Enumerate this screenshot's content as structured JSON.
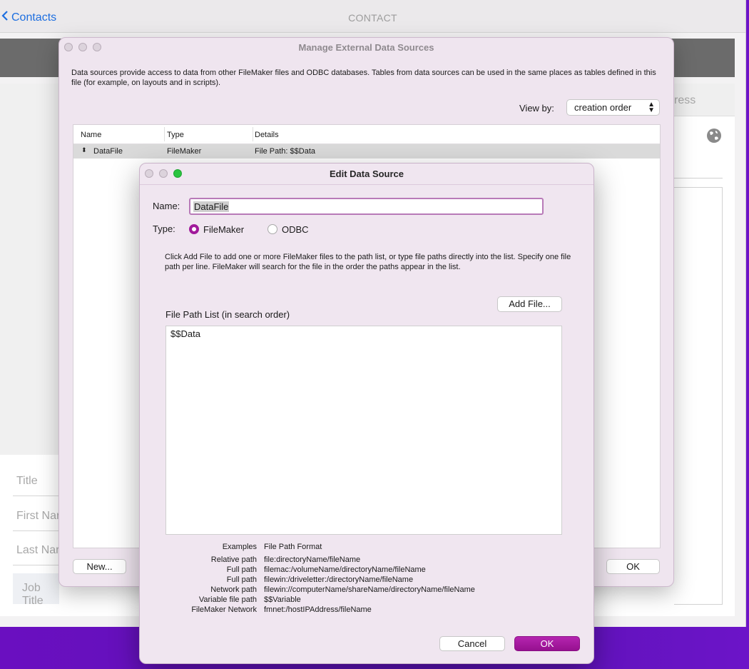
{
  "app": {
    "back_label": "Contacts",
    "title": "CONTACT",
    "tab_partial": "ress",
    "fields": [
      "Title",
      "First Nar",
      "Last Nar",
      "Job Title"
    ]
  },
  "manage": {
    "title": "Manage External Data Sources",
    "description": "Data sources provide access to data from other FileMaker files and ODBC databases. Tables from data sources can be used in the same places as tables defined in this file (for example, on layouts and in scripts).",
    "view_by_label": "View by:",
    "view_by_value": "creation order",
    "columns": [
      "Name",
      "Type",
      "Details"
    ],
    "rows": [
      {
        "name": "DataFile",
        "type": "FileMaker",
        "details": "File Path: $$Data"
      }
    ],
    "new_button": "New...",
    "ok_button": "OK"
  },
  "edit": {
    "title": "Edit Data Source",
    "name_label": "Name:",
    "name_value": "DataFile",
    "type_label": "Type:",
    "type_options": [
      "FileMaker",
      "ODBC"
    ],
    "type_selected": "FileMaker",
    "help_text": "Click Add File to add one or more FileMaker files to the path list,  or type file paths directly into the list.  Specify one file path per line.  FileMaker will search for the file in the order the paths appear in the list.",
    "add_file_button": "Add File...",
    "path_list_label": "File Path List (in search order)",
    "path_list_value": "$$Data",
    "examples_header": "Examples",
    "format_header": "File Path Format",
    "examples": [
      {
        "label": "Relative path",
        "format": "file:directoryName/fileName"
      },
      {
        "label": "Full path",
        "format": "filemac:/volumeName/directoryName/fileName"
      },
      {
        "label": "Full path",
        "format": "filewin:/driveletter:/directoryName/fileName"
      },
      {
        "label": "Network path",
        "format": "filewin://computerName/shareName/directoryName/fileName"
      },
      {
        "label": "Variable file path",
        "format": "$$Variable"
      },
      {
        "label": "FileMaker Network",
        "format": "fmnet:/hostIPAddress/fileName"
      }
    ],
    "cancel_button": "Cancel",
    "ok_button": "OK"
  },
  "colors": {
    "accent": "#a11a9b",
    "link": "#1e6fe0",
    "desktop": "#6a0fc0"
  }
}
